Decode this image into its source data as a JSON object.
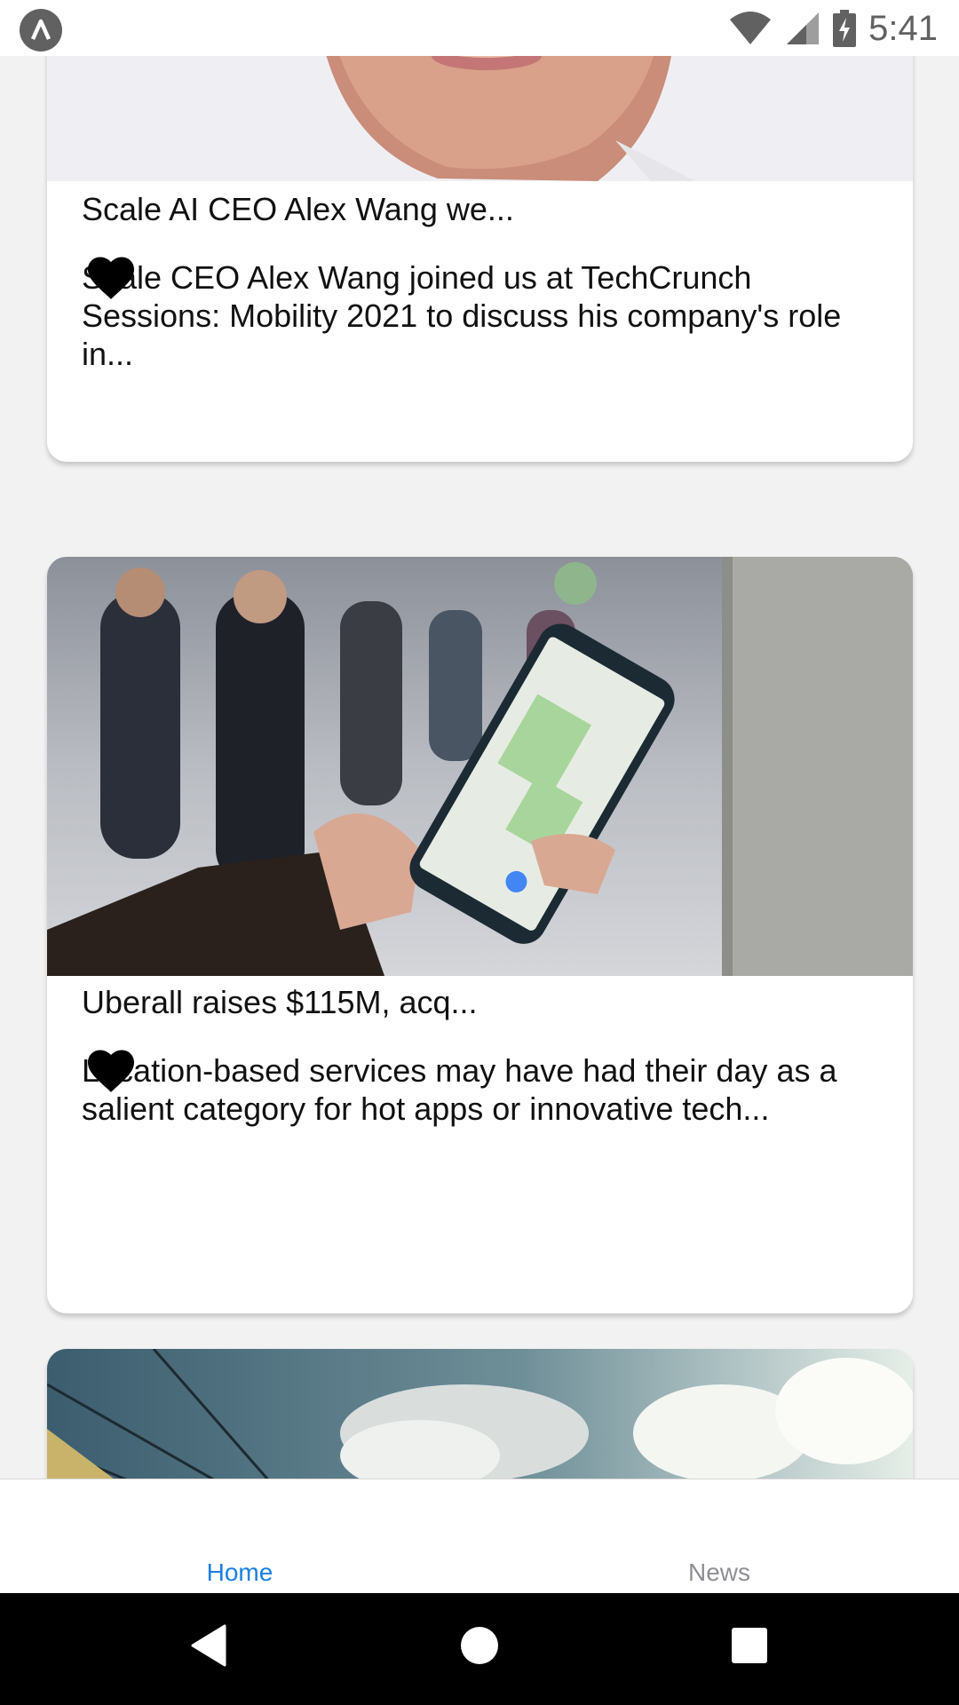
{
  "status_bar": {
    "time": "5:41",
    "icons": [
      "app-logo-icon",
      "wifi-icon",
      "cell-signal-icon",
      "battery-charging-icon"
    ]
  },
  "articles": [
    {
      "title": "Scale AI CEO Alex Wang we...",
      "description": "Scale CEO Alex Wang joined us at TechCrunch Sessions: Mobility 2021 to discuss his company's role in...",
      "image": "portrait-photo",
      "favorite_icon": "heart-icon"
    },
    {
      "title": "Uberall raises $115M, acq...",
      "description": "Location-based services may have had their day as a salient category for hot apps or innovative tech...",
      "image": "hand-holding-phone-map-photo",
      "favorite_icon": "heart-icon"
    },
    {
      "title": "",
      "description": "",
      "image": "sky-clouds-photo"
    }
  ],
  "tabs": [
    {
      "label": "Home",
      "active": true,
      "color": "#1a7fe0"
    },
    {
      "label": "News",
      "active": false,
      "color": "#8e8e93"
    }
  ],
  "nav_bar": {
    "buttons": [
      "back-icon",
      "home-icon",
      "recents-icon"
    ]
  }
}
